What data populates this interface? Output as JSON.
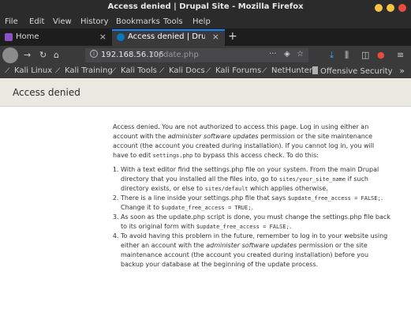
{
  "window": {
    "title": "Access denied | Drupal Site - Mozilla Firefox"
  },
  "menu": [
    "File",
    "Edit",
    "View",
    "History",
    "Bookmarks",
    "Tools",
    "Help"
  ],
  "tabs": [
    {
      "label": "Home",
      "close": "×"
    },
    {
      "label": "Access denied | Drupal S",
      "close": "×"
    }
  ],
  "newtab_label": "+",
  "urlbar": {
    "host": "192.168.56.106",
    "path": "/update.php",
    "more": "···"
  },
  "bookmarks": [
    "Kali Linux",
    "Kali Training",
    "Kali Tools",
    "Kali Docs",
    "Kali Forums",
    "NetHunter",
    "Offensive Security"
  ],
  "bookmarks_more": "»",
  "page": {
    "heading": "Access denied",
    "intro": {
      "t1": "Access denied. You are not authorized to access this page. Log in using either an account with the ",
      "em1": "administer software updates",
      "t2": " permission or the site maintenance account (the account you created during installation). If you cannot log in, you will have to edit ",
      "code1": "settings.php",
      "t3": " to bypass this access check. To do this:"
    },
    "steps": [
      {
        "t1": "With a text editor find the settings.php file on your system. From the main Drupal directory that you installed all the files into, go to ",
        "code1": "sites/your_site_name",
        "t2": " if such directory exists, or else to ",
        "code2": "sites/default",
        "t3": " which applies otherwise."
      },
      {
        "t1": "There is a line inside your settings.php file that says ",
        "code1": "$update_free_access = FALSE;",
        "t2": ". Change it to ",
        "code2": "$update_free_access = TRUE;",
        "t3": "."
      },
      {
        "t1": "As soon as the update.php script is done, you must change the settings.php file back to its original form with ",
        "code1": "$update_free_access = FALSE;",
        "t2": "."
      },
      {
        "t1": "To avoid having this problem in the future, remember to log in to your website using either an account with the ",
        "em1": "administer software updates",
        "t2": " permission or the site maintenance account (the account you created during installation) before you backup your database at the beginning of the update process."
      }
    ]
  }
}
